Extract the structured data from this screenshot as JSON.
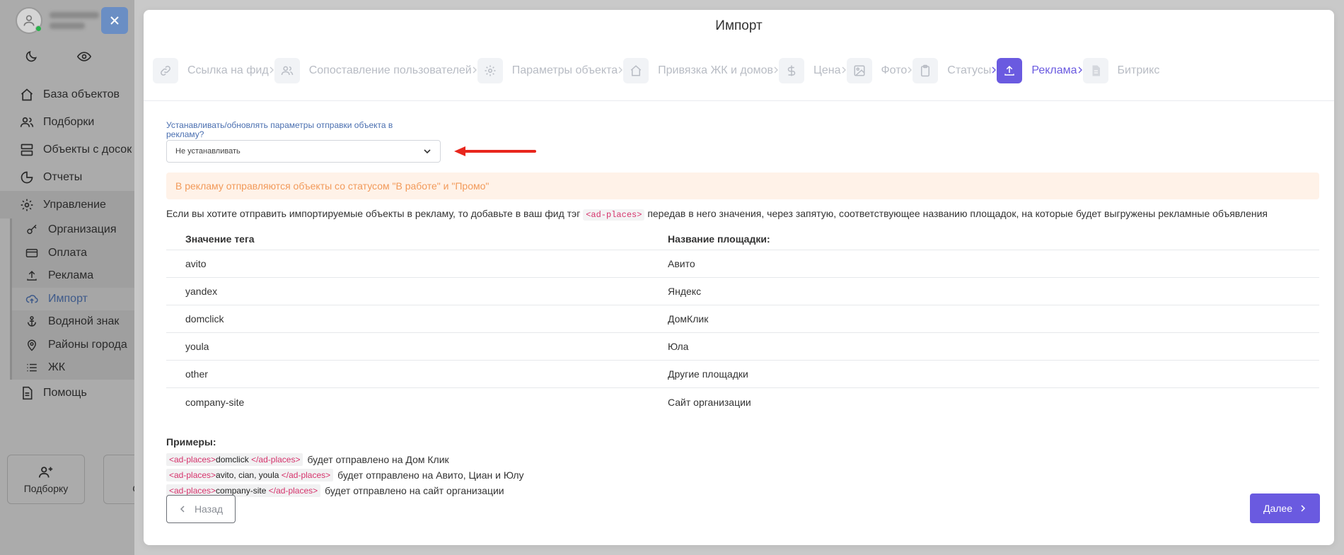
{
  "sidebar": {
    "nav": [
      {
        "label": "База объектов",
        "icon": "home-icon"
      },
      {
        "label": "Подборки",
        "icon": "users-icon"
      },
      {
        "label": "Объекты с досок",
        "icon": "server-icon"
      },
      {
        "label": "Отчеты",
        "icon": "chart-pie-icon"
      },
      {
        "label": "Управление",
        "icon": "settings-icon"
      }
    ],
    "sub": [
      {
        "label": "Организация",
        "icon": "key-icon"
      },
      {
        "label": "Оплата",
        "icon": "credit-card-icon"
      },
      {
        "label": "Реклама",
        "icon": "upload-icon"
      },
      {
        "label": "Импорт",
        "icon": "cloud-upload-icon"
      },
      {
        "label": "Водяной знак",
        "icon": "anchor-icon"
      },
      {
        "label": "Районы города",
        "icon": "location-pin-icon"
      },
      {
        "label": "ЖК",
        "icon": "list-icon"
      }
    ],
    "help": {
      "label": "Помощь",
      "icon": "document-icon"
    },
    "cards": [
      {
        "label": "Подборку",
        "icon": "user-plus-icon"
      },
      {
        "label": "Объ",
        "icon": "building-icon"
      }
    ]
  },
  "modal": {
    "title": "Импорт",
    "steps": [
      {
        "label": "Ссылка на фид",
        "icon": "link-icon"
      },
      {
        "label": "Сопоставление пользователей",
        "icon": "users-icon"
      },
      {
        "label": "Параметры объекта",
        "icon": "settings-icon"
      },
      {
        "label": "Привязка ЖК и домов",
        "icon": "home-icon"
      },
      {
        "label": "Цена",
        "icon": "dollar-icon"
      },
      {
        "label": "Фото",
        "icon": "image-icon"
      },
      {
        "label": "Статусы",
        "icon": "clipboard-icon"
      },
      {
        "label": "Реклама",
        "icon": "upload-icon",
        "active": true
      },
      {
        "label": "Битрикс",
        "icon": "file-icon"
      }
    ],
    "field_label": "Устанавливать/обновлять параметры отправки объекта в рекламу?",
    "select_value": "Не устанавливать",
    "alert": "В рекламу отправляются объекты со статусом \"В работе\" и \"Промо\"",
    "info_before": "Если вы хотите отправить импортируемые объекты в рекламу, то добавьте в ваш фид тэг",
    "info_tag": "<ad-places>",
    "info_after": "передав в него значения, через запятую, соответствующее названию площадок, на которые будет выгружены рекламные объявления",
    "table": {
      "headers": [
        "Значение тега",
        "Название площадки:"
      ],
      "rows": [
        [
          "avito",
          "Авито"
        ],
        [
          "yandex",
          "Яндекс"
        ],
        [
          "domclick",
          "ДомКлик"
        ],
        [
          "youla",
          "Юла"
        ],
        [
          "other",
          "Другие площадки"
        ],
        [
          "company-site",
          "Сайт организации"
        ]
      ]
    },
    "examples": {
      "title": "Примеры:",
      "open_tag": "<ad-places>",
      "close_tag": "</ad-places>",
      "lines": [
        {
          "value": "domclick",
          "text": "будет отправлено на Дом Клик"
        },
        {
          "value": "avito, cian, youla",
          "text": "будет отправлено на Авито, Циан и Юлу"
        },
        {
          "value": "company-site",
          "text": "будет отправлено на сайт организации"
        }
      ]
    },
    "back_label": "Назад",
    "next_label": "Далее"
  },
  "colors": {
    "accent": "#6a5ae0",
    "alert_bg": "#fff2e8",
    "alert_text": "#f29a5a",
    "tag_text": "#d6336c"
  }
}
